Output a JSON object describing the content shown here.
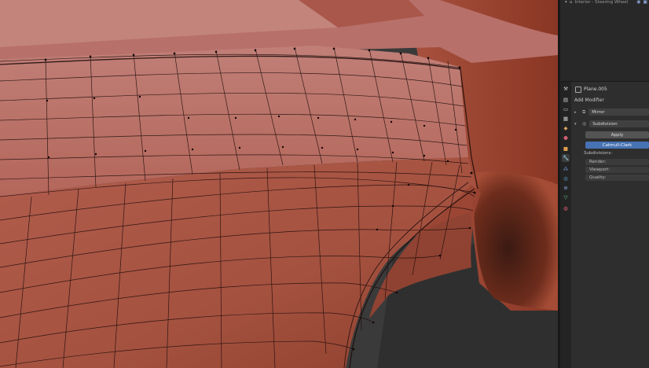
{
  "outliner": {
    "row_label": "Interior - Steering Wheel",
    "toggle_icons": [
      "eye-icon",
      "camera-icon"
    ]
  },
  "properties": {
    "object_name": "Plane.005",
    "add_modifier_label": "Add Modifier",
    "modifiers": [
      {
        "name": "Mirror",
        "icon": "mirror-modifier-icon",
        "expanded": false
      },
      {
        "name": "Subdivision",
        "icon": "subdivision-modifier-icon",
        "expanded": true
      }
    ],
    "subdivision": {
      "apply_label": "Apply",
      "algorithm_label": "Catmull-Clark",
      "section_label": "Subdivisions:",
      "render_label": "Render:",
      "viewport_label": "Viewport:",
      "quality_label": "Quality:"
    },
    "tabs": [
      "tool-tab-icon",
      "render-tab-icon",
      "output-tab-icon",
      "view-layer-tab-icon",
      "scene-tab-icon",
      "world-tab-icon",
      "object-tab-icon",
      "modifier-tab-icon",
      "particles-tab-icon",
      "physics-tab-icon",
      "constraints-tab-icon",
      "data-tab-icon",
      "material-tab-icon"
    ],
    "active_tab": "modifier-tab-icon"
  },
  "colors": {
    "accent": "#4772b3",
    "mesh_base": "#b56652",
    "mesh_highlight": "#c98a7f",
    "wire": "#1a0a08"
  }
}
